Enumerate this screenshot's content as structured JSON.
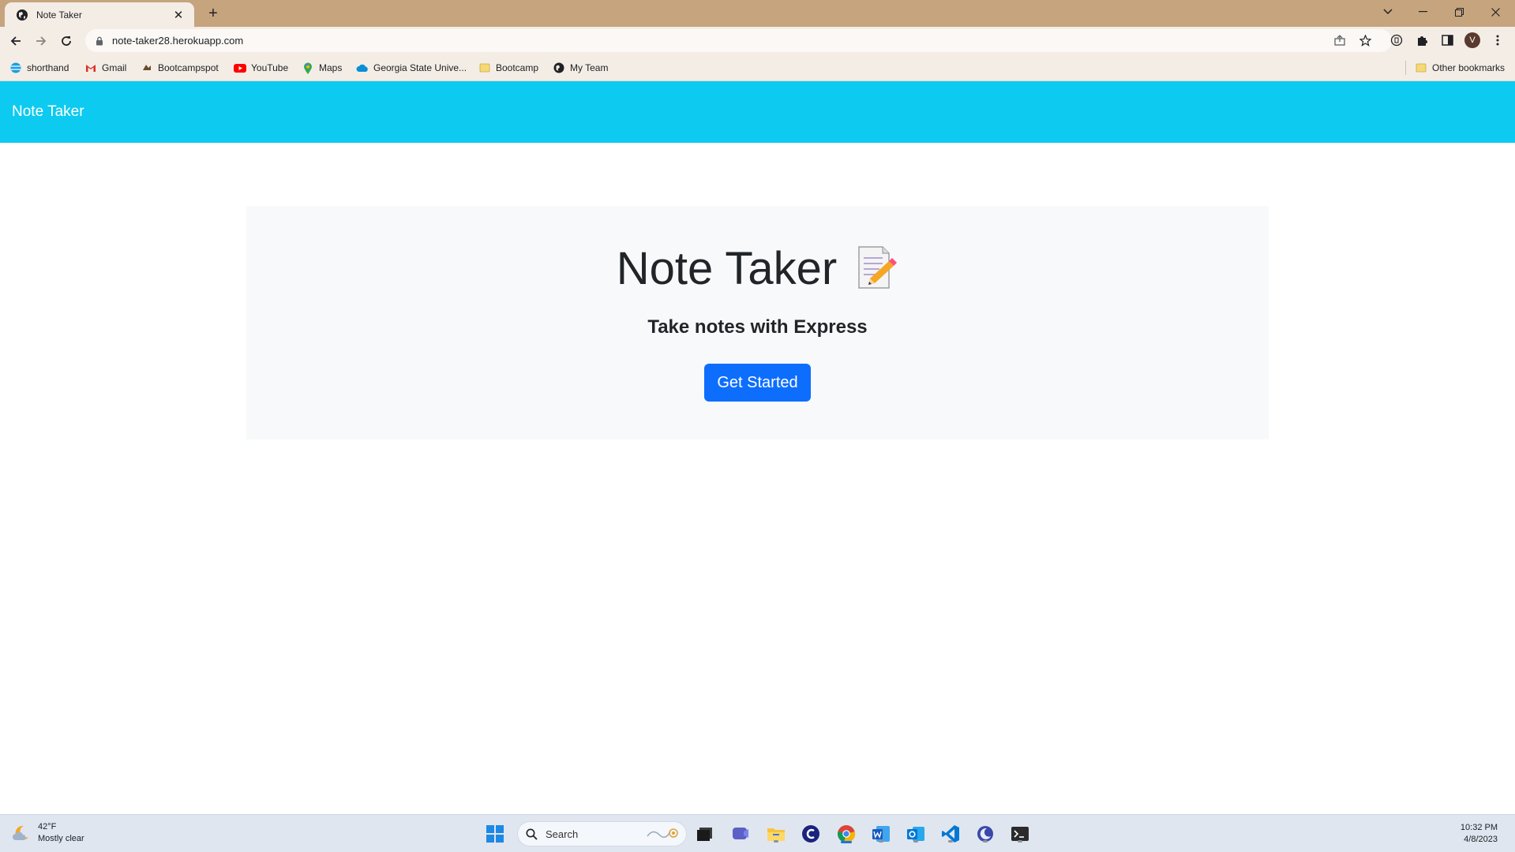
{
  "browser": {
    "tab_title": "Note Taker",
    "url": "note-taker28.herokuapp.com",
    "profile_initial": "V",
    "bookmarks": [
      {
        "label": "shorthand",
        "icon": "att-globe-icon"
      },
      {
        "label": "Gmail",
        "icon": "gmail-icon"
      },
      {
        "label": "Bootcampspot",
        "icon": "bootcampspot-icon"
      },
      {
        "label": "YouTube",
        "icon": "youtube-icon"
      },
      {
        "label": "Maps",
        "icon": "maps-pin-icon"
      },
      {
        "label": "Georgia State Unive...",
        "icon": "cloud-icon"
      },
      {
        "label": "Bootcamp",
        "icon": "folder-icon"
      },
      {
        "label": "My Team",
        "icon": "globe-icon"
      }
    ],
    "other_bookmarks": "Other bookmarks"
  },
  "navbar": {
    "brand": "Note Taker",
    "color": "#0dcaf0"
  },
  "hero": {
    "title": "Note Taker",
    "subtitle": "Take notes with Express",
    "button_label": "Get Started",
    "button_color": "#0d6efd"
  },
  "taskbar": {
    "weather_temp": "42°F",
    "weather_desc": "Mostly clear",
    "search_placeholder": "Search",
    "time": "10:32 PM",
    "date": "4/8/2023",
    "apps": [
      "start-icon",
      "task-view-icon",
      "teams-icon",
      "file-explorer-icon",
      "app-icon",
      "chrome-icon",
      "word-icon",
      "outlook-icon",
      "vscode-icon",
      "app-moon-icon",
      "terminal-icon"
    ]
  }
}
